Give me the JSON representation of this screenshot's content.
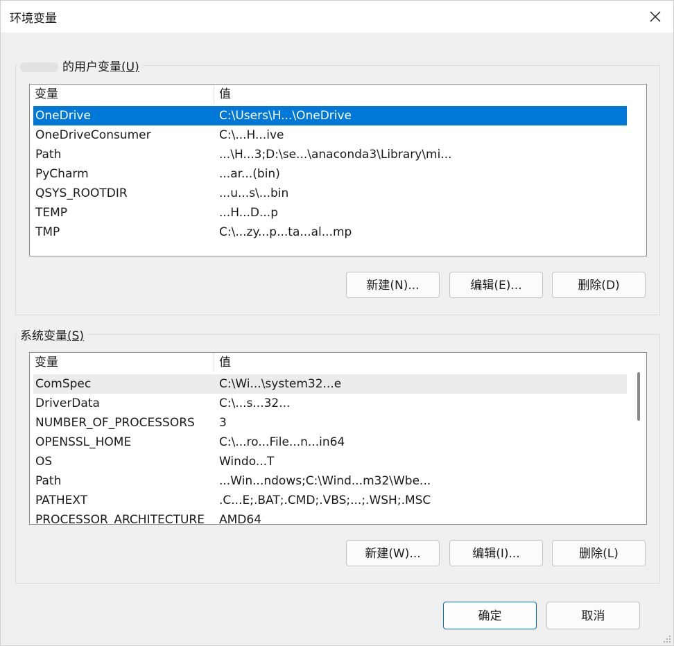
{
  "window": {
    "title": "环境变量"
  },
  "user_vars": {
    "group_label_prefix": "",
    "group_label": "的用户变量",
    "group_label_accel": "(U)",
    "col_variable": "变量",
    "col_value": "值",
    "rows": [
      {
        "name": "OneDrive",
        "value": "C:\\Users\\H...\\OneDrive"
      },
      {
        "name": "OneDriveConsumer",
        "value": "C:\\...H...ive"
      },
      {
        "name": "Path",
        "value": "...\\H...3;D:\\se...\\anaconda3\\Library\\mi..."
      },
      {
        "name": "PyCharm",
        "value": "...ar...(bin)"
      },
      {
        "name": "QSYS_ROOTDIR",
        "value": "...u...s\\...bin"
      },
      {
        "name": "TEMP",
        "value": "...H...D...p"
      },
      {
        "name": "TMP",
        "value": "C:\\...zy...p...ta...al...mp"
      }
    ],
    "buttons": {
      "new": "新建(N)...",
      "edit": "编辑(E)...",
      "delete": "删除(D)"
    }
  },
  "system_vars": {
    "group_label": "系统变量",
    "group_label_accel": "(S)",
    "col_variable": "变量",
    "col_value": "值",
    "rows": [
      {
        "name": "ComSpec",
        "value": "C:\\Wi...\\system32...e"
      },
      {
        "name": "DriverData",
        "value": "C:\\...s...32..."
      },
      {
        "name": "NUMBER_OF_PROCESSORS",
        "value": "3"
      },
      {
        "name": "OPENSSL_HOME",
        "value": "C:\\...ro...File...n...in64"
      },
      {
        "name": "OS",
        "value": "Windo...T"
      },
      {
        "name": "Path",
        "value": "...Win...ndows;C:\\Wind...m32\\Wbe..."
      },
      {
        "name": "PATHEXT",
        "value": ".C...E;.BAT;.CMD;.VBS;...;.WSH;.MSC"
      },
      {
        "name": "PROCESSOR_ARCHITECTURE",
        "value": "AMD64"
      }
    ],
    "buttons": {
      "new": "新建(W)...",
      "edit": "编辑(I)...",
      "delete": "删除(L)"
    }
  },
  "footer": {
    "ok": "确定",
    "cancel": "取消"
  },
  "colors": {
    "selection": "#0078d7",
    "primary_border": "#0067c0",
    "dialog_bg": "#f0f0f0"
  }
}
